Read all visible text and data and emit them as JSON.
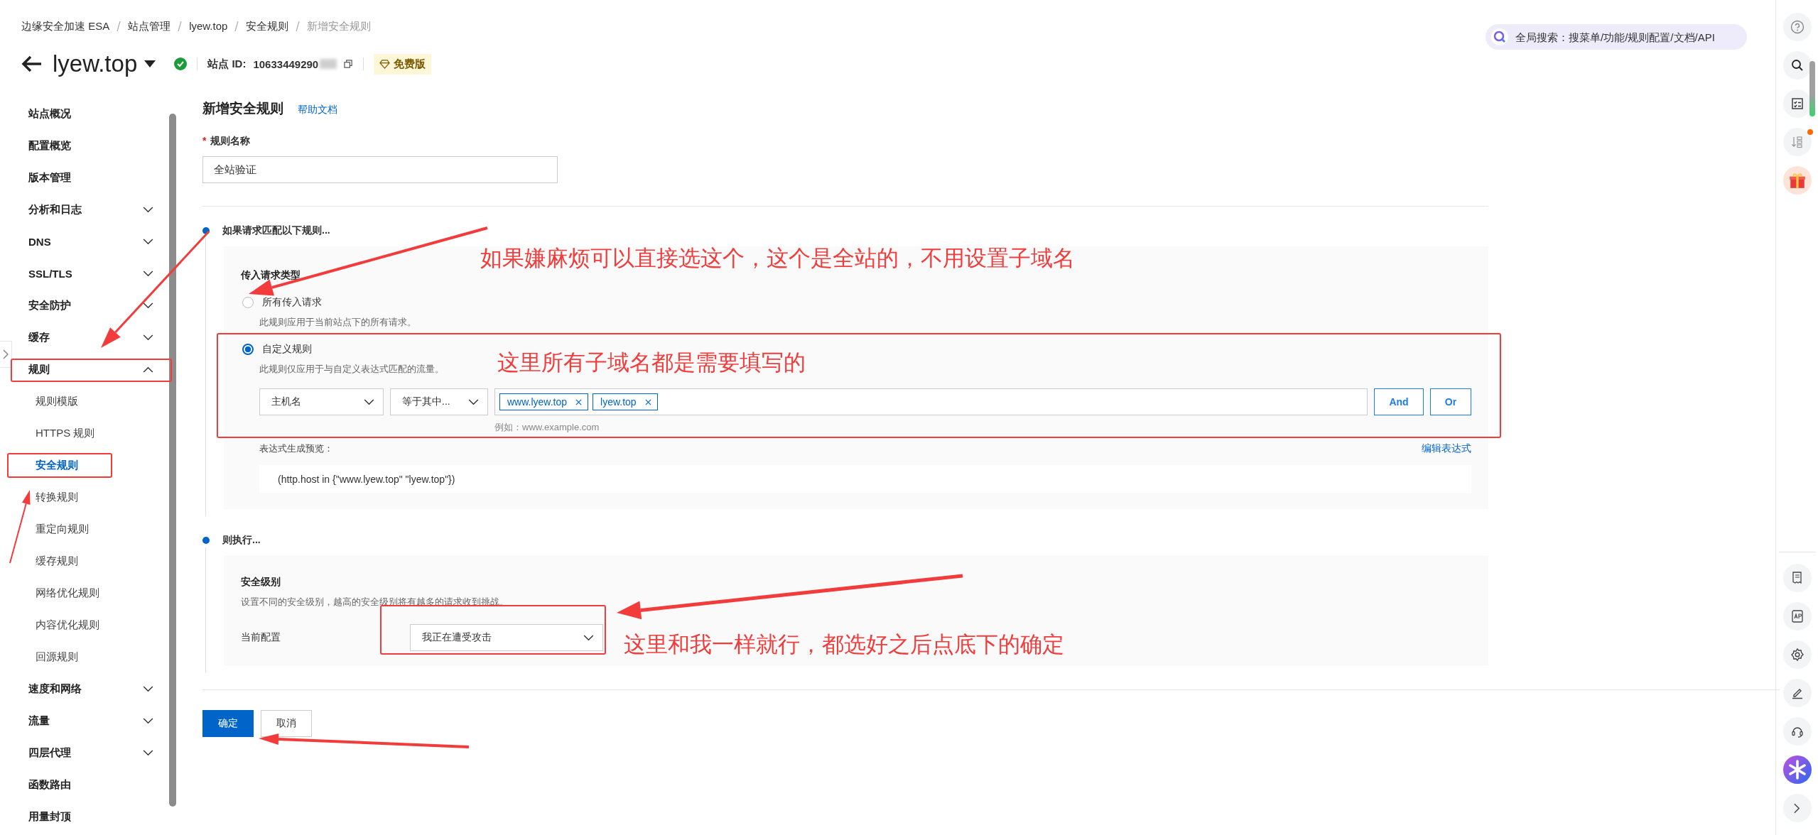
{
  "breadcrumb": [
    {
      "label": "边缘安全加速 ESA",
      "current": false
    },
    {
      "label": "站点管理",
      "current": false
    },
    {
      "label": "lyew.top",
      "current": false
    },
    {
      "label": "安全规则",
      "current": false
    },
    {
      "label": "新增安全规则",
      "current": true
    }
  ],
  "site": {
    "name": "lyew.top",
    "verified": true,
    "id_label": "站点 ID:",
    "id": "10633449290",
    "plan": "免费版"
  },
  "global_search": {
    "placeholder": "全局搜索：搜菜单/功能/规则配置/文档/API"
  },
  "sidebar": {
    "items": [
      {
        "label": "站点概况",
        "kind": "link"
      },
      {
        "label": "配置概览",
        "kind": "link"
      },
      {
        "label": "版本管理",
        "kind": "link"
      },
      {
        "label": "分析和日志",
        "kind": "group",
        "expanded": false
      },
      {
        "label": "DNS",
        "kind": "group",
        "expanded": false
      },
      {
        "label": "SSL/TLS",
        "kind": "group",
        "expanded": false
      },
      {
        "label": "安全防护",
        "kind": "group",
        "expanded": false
      },
      {
        "label": "缓存",
        "kind": "group",
        "expanded": false
      },
      {
        "label": "规则",
        "kind": "group",
        "expanded": true,
        "children": [
          {
            "label": "规则模版",
            "selected": false
          },
          {
            "label": "HTTPS 规则",
            "selected": false
          },
          {
            "label": "安全规则",
            "selected": true
          },
          {
            "label": "转换规则",
            "selected": false
          },
          {
            "label": "重定向规则",
            "selected": false
          },
          {
            "label": "缓存规则",
            "selected": false
          },
          {
            "label": "网络优化规则",
            "selected": false
          },
          {
            "label": "内容优化规则",
            "selected": false
          },
          {
            "label": "回源规则",
            "selected": false
          }
        ]
      },
      {
        "label": "速度和网络",
        "kind": "group",
        "expanded": false
      },
      {
        "label": "流量",
        "kind": "group",
        "expanded": false
      },
      {
        "label": "四层代理",
        "kind": "group",
        "expanded": false
      },
      {
        "label": "函数路由",
        "kind": "link"
      },
      {
        "label": "用量封顶",
        "kind": "link"
      }
    ]
  },
  "form": {
    "title": "新增安全规则",
    "help_link": "帮助文档",
    "name_field": {
      "label": "规则名称",
      "required_mark": "*",
      "value": "全站验证"
    },
    "match_section": {
      "title": "如果请求匹配以下规则...",
      "request_type_label": "传入请求类型",
      "options": [
        {
          "label": "所有传入请求",
          "description": "此规则应用于当前站点下的所有请求。",
          "selected": false
        },
        {
          "label": "自定义规则",
          "description": "此规则仅应用于与自定义表达式匹配的流量。",
          "selected": true
        }
      ],
      "condition": {
        "field": "主机名",
        "operator": "等于其中...",
        "tags": [
          "www.lyew.top",
          "lyew.top"
        ],
        "hint": "例如：www.example.com",
        "buttons": [
          "And",
          "Or"
        ]
      },
      "preview_label": "表达式生成预览：",
      "edit_link": "编辑表达式",
      "preview": "(http.host in {\"www.lyew.top\" \"lyew.top\"})"
    },
    "action_section": {
      "title": "则执行...",
      "level_title": "安全级别",
      "level_description": "设置不同的安全级别，越高的安全级别将有越多的请求收到挑战。",
      "config_label": "当前配置",
      "config_value": "我正在遭受攻击"
    },
    "buttons": [
      {
        "label": "确定",
        "primary": true
      },
      {
        "label": "取消",
        "primary": false
      }
    ]
  },
  "annotations": [
    {
      "text": "如果嫌麻烦可以直接选这个，这个是全站的，不用设置子域名"
    },
    {
      "text": "这里所有子域名都是需要填写的"
    },
    {
      "text": "这里和我一样就行，都选好之后点底下的确定"
    }
  ]
}
